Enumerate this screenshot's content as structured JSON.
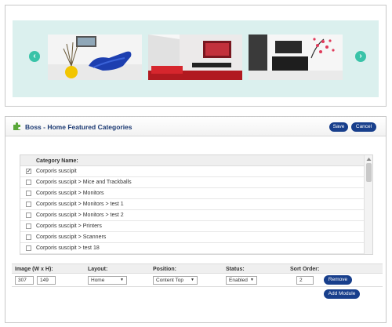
{
  "carousel": {
    "prev_icon": "‹",
    "next_icon": "›",
    "accent_color": "#39c3a8",
    "background_color": "#dbf0ee",
    "slides": [
      {
        "name": "blue-lounge-chair-room"
      },
      {
        "name": "red-sofa-living-room"
      },
      {
        "name": "black-tv-stand-room"
      }
    ]
  },
  "module": {
    "title": "Boss - Home Featured Categories",
    "icon": "puzzle-icon",
    "save_label": "Save",
    "cancel_label": "Cancel",
    "brand_color": "#183f8c"
  },
  "categories": {
    "header": "Category Name:",
    "items": [
      {
        "label": "Corporis suscipit",
        "checked": true
      },
      {
        "label": "Corporis suscipit > Mice and Trackballs",
        "checked": false
      },
      {
        "label": "Corporis suscipit > Monitors",
        "checked": false
      },
      {
        "label": "Corporis suscipit > Monitors > test 1",
        "checked": false
      },
      {
        "label": "Corporis suscipit > Monitors > test 2",
        "checked": false
      },
      {
        "label": "Corporis suscipit > Printers",
        "checked": false
      },
      {
        "label": "Corporis suscipit > Scanners",
        "checked": false
      },
      {
        "label": "Corporis suscipit > test 18",
        "checked": false
      }
    ]
  },
  "settings": {
    "headers": {
      "image": "Image (W x H):",
      "layout": "Layout:",
      "position": "Position:",
      "status": "Status:",
      "sort_order": "Sort Order:"
    },
    "row": {
      "width": "307",
      "height": "149",
      "layout": "Home",
      "position": "Content Top",
      "status": "Enabled",
      "sort_order": "2",
      "remove_label": "Remove"
    },
    "add_module_label": "Add Module"
  }
}
